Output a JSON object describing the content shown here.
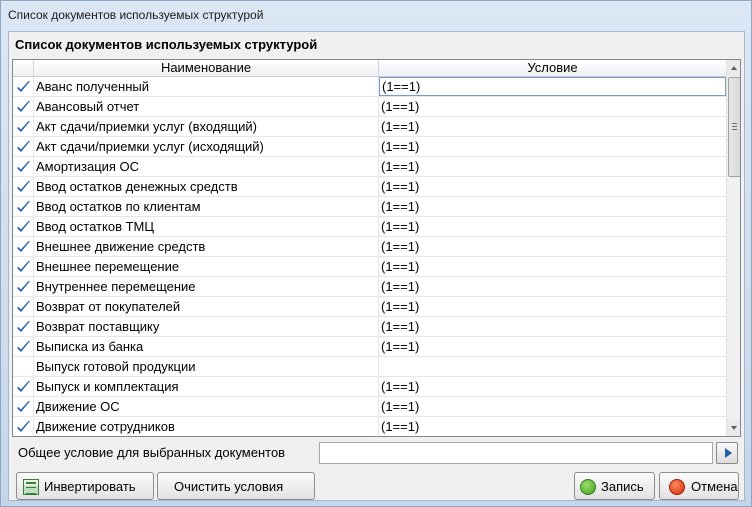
{
  "window": {
    "title": "Список документов используемых структурой"
  },
  "panel": {
    "title": "Список документов используемых структурой"
  },
  "grid": {
    "columns": {
      "name": "Наименование",
      "condition": "Условие"
    },
    "rows": [
      {
        "checked": true,
        "name": "Аванс полученный",
        "condition": "(1==1)"
      },
      {
        "checked": true,
        "name": "Авансовый отчет",
        "condition": "(1==1)"
      },
      {
        "checked": true,
        "name": "Акт сдачи/приемки услуг (входящий)",
        "condition": "(1==1)"
      },
      {
        "checked": true,
        "name": "Акт сдачи/приемки услуг (исходящий)",
        "condition": "(1==1)"
      },
      {
        "checked": true,
        "name": "Амортизация ОС",
        "condition": "(1==1)"
      },
      {
        "checked": true,
        "name": "Ввод остатков денежных средств",
        "condition": "(1==1)"
      },
      {
        "checked": true,
        "name": "Ввод остатков по клиентам",
        "condition": "(1==1)"
      },
      {
        "checked": true,
        "name": "Ввод остатков ТМЦ",
        "condition": "(1==1)"
      },
      {
        "checked": true,
        "name": "Внешнее движение средств",
        "condition": "(1==1)"
      },
      {
        "checked": true,
        "name": "Внешнее перемещение",
        "condition": "(1==1)"
      },
      {
        "checked": true,
        "name": "Внутреннее перемещение",
        "condition": "(1==1)"
      },
      {
        "checked": true,
        "name": "Возврат от покупателей",
        "condition": "(1==1)"
      },
      {
        "checked": true,
        "name": "Возврат поставщику",
        "condition": "(1==1)"
      },
      {
        "checked": true,
        "name": "Выписка из банка",
        "condition": "(1==1)"
      },
      {
        "checked": false,
        "name": "Выпуск готовой продукции",
        "condition": ""
      },
      {
        "checked": true,
        "name": "Выпуск и комплектация",
        "condition": "(1==1)"
      },
      {
        "checked": true,
        "name": "Движение ОС",
        "condition": "(1==1)"
      },
      {
        "checked": true,
        "name": "Движение сотрудников",
        "condition": "(1==1)"
      }
    ]
  },
  "general": {
    "label": "Общее условие для выбранных документов",
    "value": ""
  },
  "buttons": {
    "invert": "Инвертировать",
    "clear": "Очистить условия",
    "save": "Запись",
    "cancel": "Отмена"
  },
  "colors": {
    "check": "#1f5fae",
    "accent": "#7a9cc6"
  }
}
